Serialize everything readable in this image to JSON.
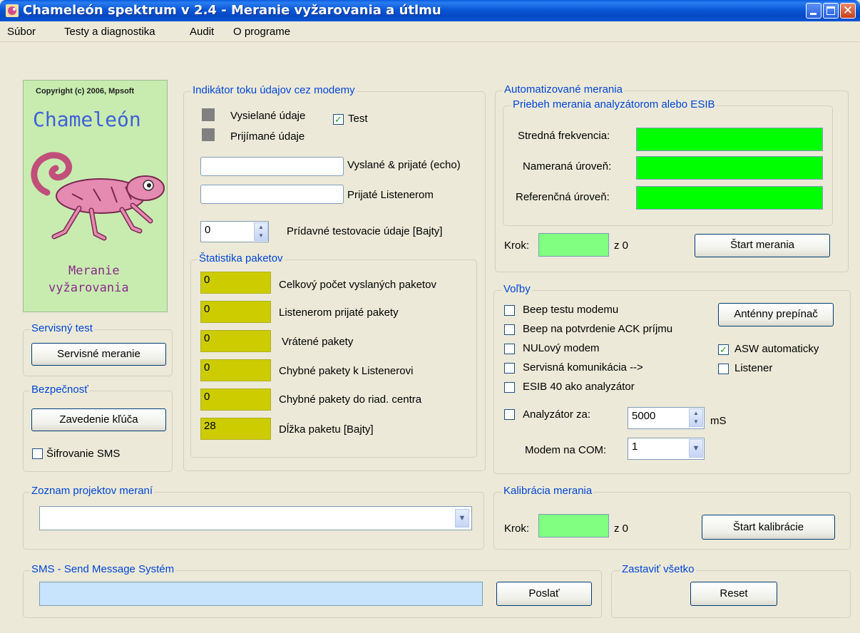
{
  "window": {
    "title": "Chameleón spektrum v 2.4 - Meranie vyžarovania a útlmu"
  },
  "menu": {
    "items": [
      {
        "label": "Súbor"
      },
      {
        "label": "Testy a diagnostika"
      },
      {
        "label": "Audit"
      },
      {
        "label": "O programe"
      }
    ]
  },
  "logo": {
    "copyright": "Copyright (c) 2006, Mpsoft",
    "name": "Chameleón",
    "caption_line1": "Meranie",
    "caption_line2": "vyžarovania"
  },
  "service_test": {
    "title": "Servisný test",
    "button": "Servisné meranie"
  },
  "security": {
    "title": "Bezpečnosť",
    "button": "Zavedenie kľúča",
    "checkbox": "Šifrovanie SMS",
    "checked": false
  },
  "indicator": {
    "title": "Indikátor toku údajov cez modemy",
    "sent": "Vysielané údaje",
    "received": "Prijímané údaje",
    "test_label": "Test",
    "test_checked": true,
    "echo_label": "Vyslané & prijaté (echo)",
    "echo_value": "",
    "listener_label": "Prijaté Listenerom",
    "listener_value": "",
    "extra_label": "Prídavné testovacie údaje [Bajty]",
    "extra_value": "0"
  },
  "stats": {
    "title": "Štatistika paketov",
    "rows": [
      {
        "value": "0",
        "label": "Celkový počet vyslaných paketov"
      },
      {
        "value": "0",
        "label": "Listenerom prijaté pakety"
      },
      {
        "value": "0",
        "label": "Vrátené pakety"
      },
      {
        "value": "0",
        "label": "Chybné pakety k Listenerovi"
      },
      {
        "value": "0",
        "label": "Chybné pakety do riad. centra"
      },
      {
        "value": "28",
        "label": "Dĺžka paketu [Bajty]"
      }
    ]
  },
  "auto": {
    "title": "Automatizované merania",
    "subtitle": "Priebeh merania analyzátorom alebo ESIB",
    "freq_label": "Stredná frekvencia:",
    "measured_label": "Nameraná úroveň:",
    "reference_label": "Referenčná úroveň:",
    "step_label": "Krok:",
    "step_of": "z 0",
    "start_button": "Štart merania"
  },
  "options": {
    "title": "Voľby",
    "checkboxes": [
      {
        "label": "Beep testu modemu",
        "checked": false
      },
      {
        "label": "Beep na potvrdenie ACK príjmu",
        "checked": false
      },
      {
        "label": "NULový modem",
        "checked": false
      },
      {
        "label": "Servisná komunikácia  -->",
        "checked": false
      },
      {
        "label": "ESIB 40 ako analyzátor",
        "checked": false
      }
    ],
    "antenna_button": "Anténny prepínač",
    "asw_label": "ASW automaticky",
    "asw_checked": true,
    "listener_label": "Listener",
    "listener_checked": false,
    "analyzer_label": "Analyzátor za:",
    "analyzer_checked": false,
    "analyzer_value": "5000",
    "analyzer_unit": "mS",
    "com_label": "Modem na COM:",
    "com_value": "1"
  },
  "projects": {
    "title": "Zoznam projektov meraní",
    "value": ""
  },
  "calibration": {
    "title": "Kalibrácia merania",
    "step_label": "Krok:",
    "step_of": "z 0",
    "start_button": "Štart kalibrácie"
  },
  "sms": {
    "title": "SMS - Send Message Systém",
    "value": "",
    "send_button": "Poslať"
  },
  "stop_all": {
    "title": "Zastaviť všetko",
    "reset_button": "Reset"
  },
  "colors": {
    "accent": "#0046d5",
    "green": "#00ff00",
    "light_green": "#80ff80",
    "yellow": "#cccc00",
    "sms_input": "#c8e4fc"
  }
}
